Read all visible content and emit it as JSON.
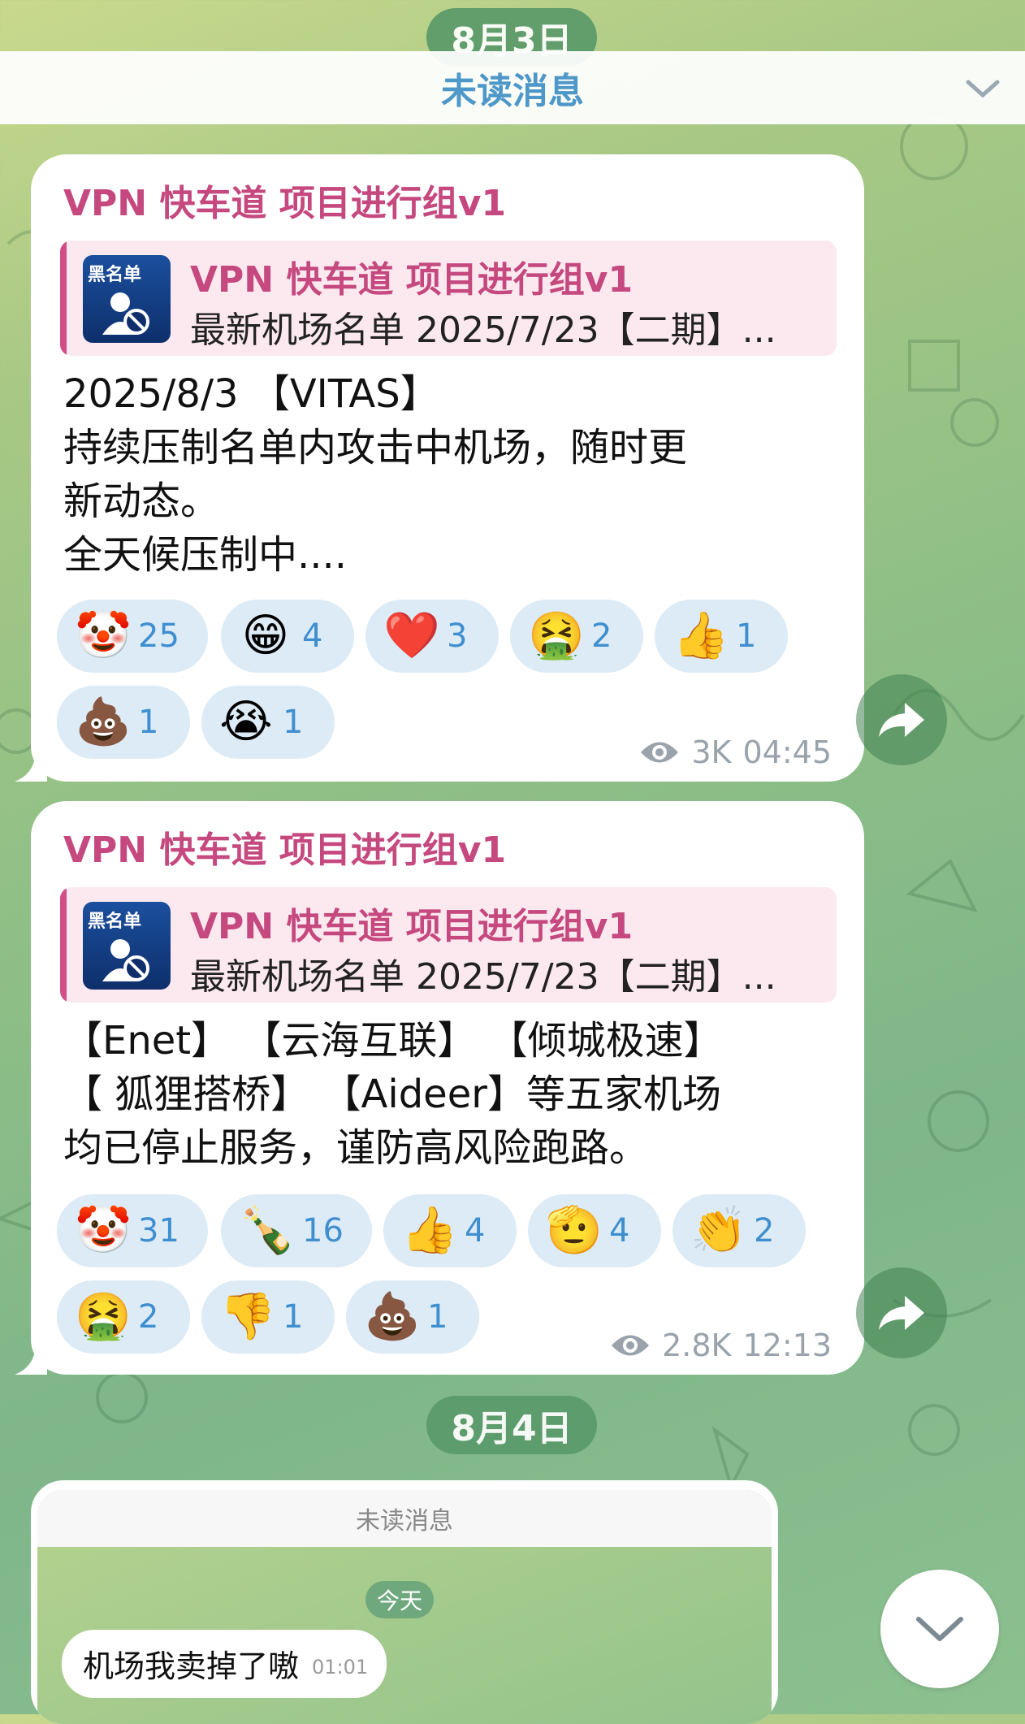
{
  "dates": {
    "first": "8月3日",
    "second": "8月4日"
  },
  "unread": {
    "label": "未读消息"
  },
  "messages": [
    {
      "sender": "VPN 快车道 项目进行组v1",
      "quote": {
        "thumb_label": "黑名单",
        "name": "VPN 快车道 项目进行组v1",
        "text": "最新机场名单 2025/7/23【二期】..."
      },
      "lines": [
        "2025/8/3 【VITAS】",
        "持续压制名单内攻击中机场，随时更",
        "新动态。",
        "全天候压制中...."
      ],
      "reactions": [
        {
          "emoji": "🤡",
          "count": "25"
        },
        {
          "emoji": "😁",
          "count": "4"
        },
        {
          "emoji": "❤️",
          "count": "3"
        },
        {
          "emoji": "🤮",
          "count": "2"
        },
        {
          "emoji": "👍",
          "count": "1"
        },
        {
          "emoji": "💩",
          "count": "1"
        },
        {
          "emoji": "😭",
          "count": "1"
        }
      ],
      "views": "3K",
      "time": "04:45"
    },
    {
      "sender": "VPN 快车道 项目进行组v1",
      "quote": {
        "thumb_label": "黑名单",
        "name": "VPN 快车道 项目进行组v1",
        "text": "最新机场名单 2025/7/23【二期】..."
      },
      "lines": [
        "【Enet】 【云海互联】 【倾城极速】",
        "【 狐狸搭桥】 【Aideer】等五家机场",
        "均已停止服务，谨防高风险跑路。"
      ],
      "reactions": [
        {
          "emoji": "🤡",
          "count": "31"
        },
        {
          "emoji": "🍾",
          "count": "16"
        },
        {
          "emoji": "👍",
          "count": "4"
        },
        {
          "emoji": "🫡",
          "count": "4"
        },
        {
          "emoji": "👏",
          "count": "2"
        },
        {
          "emoji": "🤮",
          "count": "2"
        },
        {
          "emoji": "👎",
          "count": "1"
        },
        {
          "emoji": "💩",
          "count": "1"
        }
      ],
      "views": "2.8K",
      "time": "12:13"
    }
  ],
  "screenshot": {
    "unread_label": "未读消息",
    "date_pill": "今天",
    "message_text": "机场我卖掉了嗷",
    "message_time": "01:01"
  },
  "icons": {
    "forward": "forward-arrow-icon",
    "views": "eye-icon",
    "scroll_down": "chevron-down-icon",
    "unread_collapse": "chevron-down-icon"
  },
  "colors": {
    "sender": "#c5487e",
    "reaction_bg": "#dcebf6",
    "reaction_count": "#3f8fd0",
    "unread": "#4e97c9"
  }
}
